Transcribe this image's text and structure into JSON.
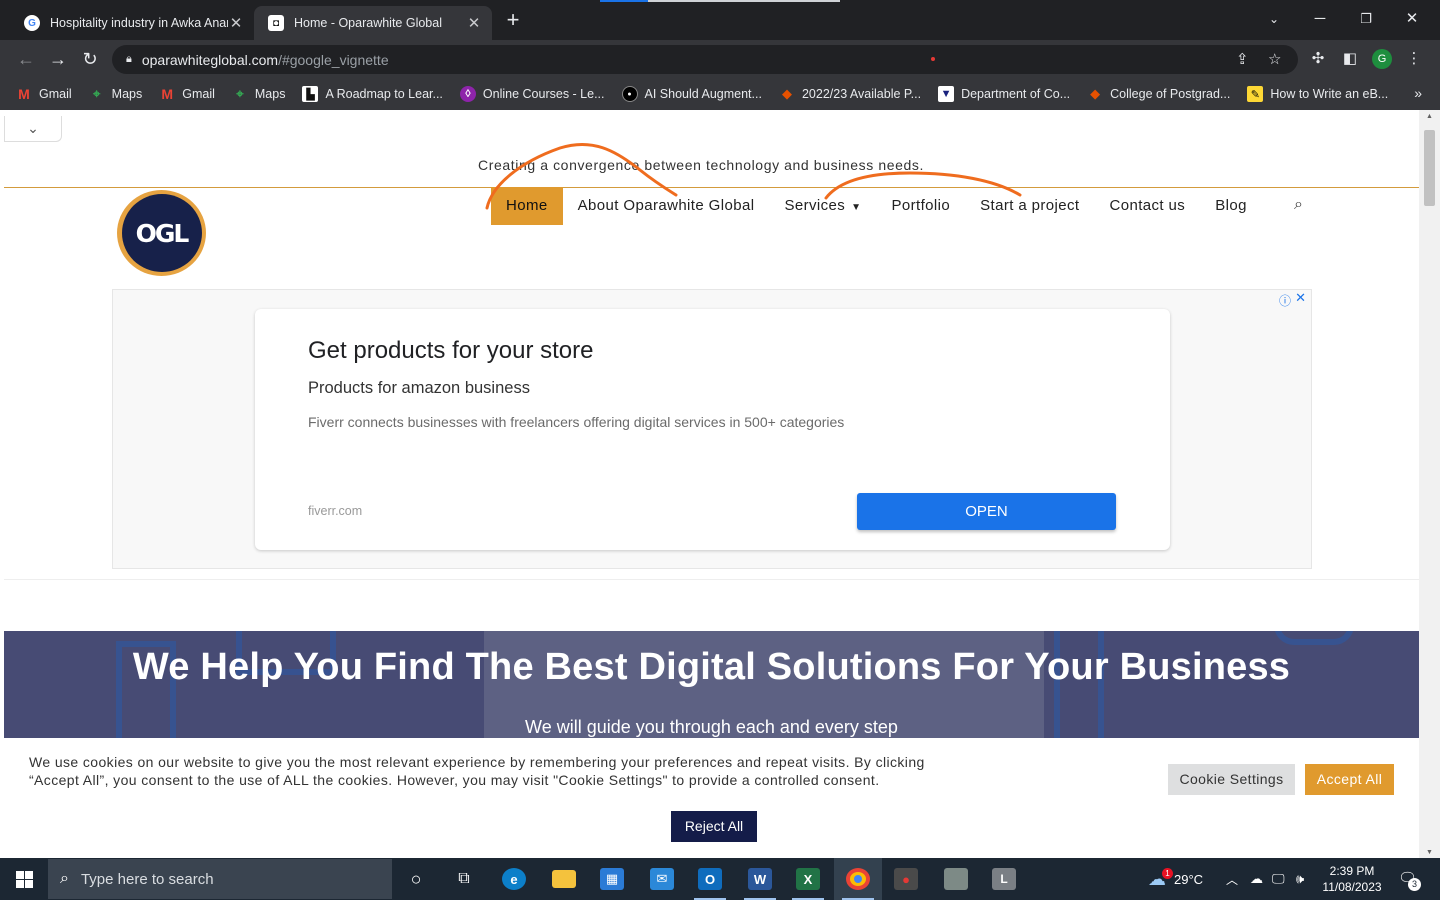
{
  "browser": {
    "tabs": [
      {
        "title": "Hospitality industry in Awka Anambra",
        "favicon": "google-icon",
        "active": false
      },
      {
        "title": "Home - Oparawhite Global",
        "favicon": "site-icon",
        "active": true
      }
    ],
    "address": {
      "host": "oparawhiteglobal.com",
      "path": "/#google_vignette"
    },
    "profile_initial": "G",
    "bookmarks": [
      {
        "label": "Gmail",
        "icon": "gmail-icon"
      },
      {
        "label": "Maps",
        "icon": "maps-icon"
      },
      {
        "label": "Gmail",
        "icon": "gmail-icon"
      },
      {
        "label": "Maps",
        "icon": "maps-icon"
      },
      {
        "label": "A Roadmap to Lear...",
        "icon": "roadmap-icon"
      },
      {
        "label": "Online Courses - Le...",
        "icon": "courses-icon"
      },
      {
        "label": "AI Should Augment...",
        "icon": "hbr-icon"
      },
      {
        "label": "2022/23 Available P...",
        "icon": "university-icon"
      },
      {
        "label": "Department of Co...",
        "icon": "department-icon"
      },
      {
        "label": "College of Postgrad...",
        "icon": "university-icon"
      },
      {
        "label": "How to Write an eB...",
        "icon": "writing-icon"
      }
    ]
  },
  "site": {
    "tagline": "Creating a convergence between technology and business needs.",
    "logo_text": "OGL",
    "nav": [
      {
        "label": "Home",
        "current": true
      },
      {
        "label": "About Oparawhite Global"
      },
      {
        "label": "Services",
        "dropdown": true
      },
      {
        "label": "Portfolio"
      },
      {
        "label": "Start a project"
      },
      {
        "label": "Contact us"
      },
      {
        "label": "Blog"
      }
    ],
    "ad": {
      "title": "Get products for your store",
      "subtitle": "Products for amazon business",
      "description": "Fiverr connects businesses with freelancers offering digital services in 500+ categories",
      "domain": "fiverr.com",
      "cta": "OPEN"
    },
    "hero": {
      "heading": "We Help You Find The Best Digital Solutions For Your Business",
      "subheading": "We will guide you through each and every step"
    },
    "cookie": {
      "text": "We use cookies on our website to give you the most relevant experience by remembering your preferences and repeat visits. By clicking “Accept All”, you consent to the use of ALL the cookies. However, you may visit \"Cookie Settings\" to provide a controlled consent.",
      "settings_label": "Cookie Settings",
      "accept_label": "Accept All",
      "reject_label": "Reject All"
    },
    "colors": {
      "accent": "#e09a2e",
      "navy": "#141c49",
      "ad_button": "#1a73e8"
    }
  },
  "taskbar": {
    "search_placeholder": "Type here to search",
    "weather": "29°C",
    "weather_badge": "1",
    "time": "2:39 PM",
    "date": "11/08/2023",
    "notifications": "3"
  }
}
